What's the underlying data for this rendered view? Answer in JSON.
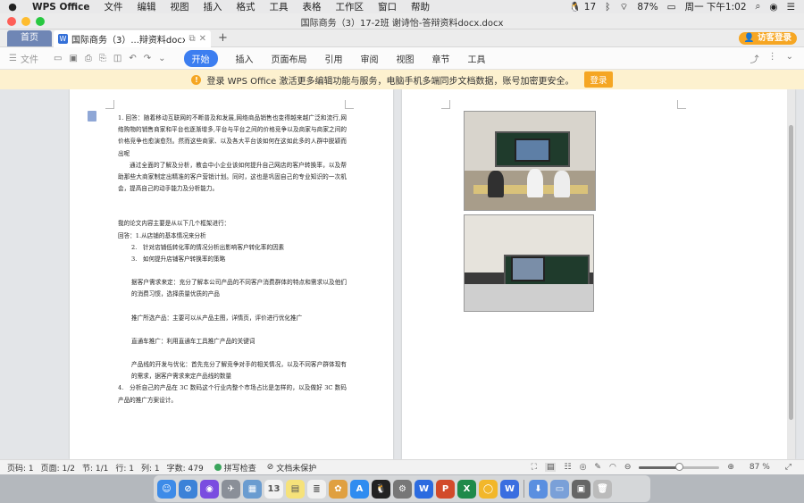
{
  "menubar": {
    "app_name": "WPS Office",
    "items": [
      "文件",
      "编辑",
      "视图",
      "插入",
      "格式",
      "工具",
      "表格",
      "工作区",
      "窗口",
      "帮助"
    ],
    "status": {
      "notification_count": "17",
      "battery": "87%",
      "clock": "周一 下午1:02"
    }
  },
  "window": {
    "title": "国际商务（3）17-2班 谢诗怡-答辩资料docx.docx"
  },
  "tabs": {
    "home": "首页",
    "doc": "国际商务（3）...辩资料docx",
    "visitor_login": "访客登录"
  },
  "ribbon": {
    "file": "文件",
    "tabs": [
      "开始",
      "插入",
      "页面布局",
      "引用",
      "审阅",
      "视图",
      "章节",
      "工具"
    ],
    "active_tab": "开始"
  },
  "notice": {
    "text": "登录 WPS Office 激活更多编辑功能与服务，电脑手机多端同步文档数据，账号加密更安全。",
    "button": "登录"
  },
  "document": {
    "paragraphs": [
      {
        "text": "1. 回答：随着移动互联网的不断普及和发展,网络商品销售也变得越来越广泛和流行,网络购物的销售商家和平台也逐渐增多,平台与平台之间的价格竞争以及商家与商家之间的价格竞争也愈演愈烈。然而这些商家、以及各大平台该如何在这如此多的人群中脱颖而出呢",
        "style": ""
      },
      {
        "text": "通过全面的了解及分析，教会中小企业该如何提升自己网店的客户转换率，以及帮助那些大商家制定出精准的客户营销计划。同时，这也是巩固自己的专业知识的一次机会，提高自己的动手能力及分析能力。",
        "style": "indent"
      },
      {
        "text": "",
        "style": "gap1"
      },
      {
        "text": "我的论文内容主要是从以下几个框架进行：",
        "style": ""
      },
      {
        "text": "回答：1.从店铺的基本情况来分析",
        "style": ""
      },
      {
        "text": "2.　针对店铺低转化率的情况分析出影响客户转化率的因素",
        "style": "i2"
      },
      {
        "text": "3.　如何提升店铺客户转换率的策略",
        "style": "i2"
      },
      {
        "text": "",
        "style": "gap2"
      },
      {
        "text": "据客户需求来定：充分了解本公司产品的不同客户消费群体的特点和需求以及他们的消费习惯，选择质量优质的产品",
        "style": "i3"
      },
      {
        "text": "",
        "style": "gap2"
      },
      {
        "text": "推广所选产品：主要可以从产品主图，详情页，评价进行优化推广",
        "style": "i3"
      },
      {
        "text": "",
        "style": "gap2"
      },
      {
        "text": "直通车推广：利用直通车工具推广产品的关键词",
        "style": "i3"
      },
      {
        "text": "",
        "style": "gap2"
      },
      {
        "text": "产品线的开发与优化：首先充分了解竞争对手的相关情况，以及不同客户群体现有的需求，据客户需求来定产品线的数量",
        "style": "i3"
      },
      {
        "text": "4.　分析自己的产品在 3C 数码这个行业内整个市场占比是怎样的，以及做好 3C 数码产品的推广方案设计。",
        "style": "i4"
      }
    ]
  },
  "statusbar": {
    "page_num": "页码: 1",
    "page_count": "页面: 1/2",
    "section": "节: 1/1",
    "row": "行: 1",
    "column": "列: 1",
    "word_count": "字数: 479",
    "spell_check": "拼写检查",
    "doc_unsaved": "文档未保护",
    "zoom": "87 %",
    "zoom_level": 0.5
  },
  "dock": {
    "icons": [
      "finder-icon",
      "safari-icon",
      "siri-icon",
      "launchpad-icon",
      "preview-icon",
      "calendar-icon",
      "notes-icon",
      "reminders-icon",
      "photos-icon",
      "appstore-icon",
      "qq-icon",
      "settings-icon",
      "word-icon",
      "powerpoint-icon",
      "excel-icon",
      "wps-pdf-icon",
      "wps-icon",
      "downloads-icon",
      "folder-icon",
      "screen-icon",
      "trash-icon"
    ],
    "qq_badge": "17"
  }
}
